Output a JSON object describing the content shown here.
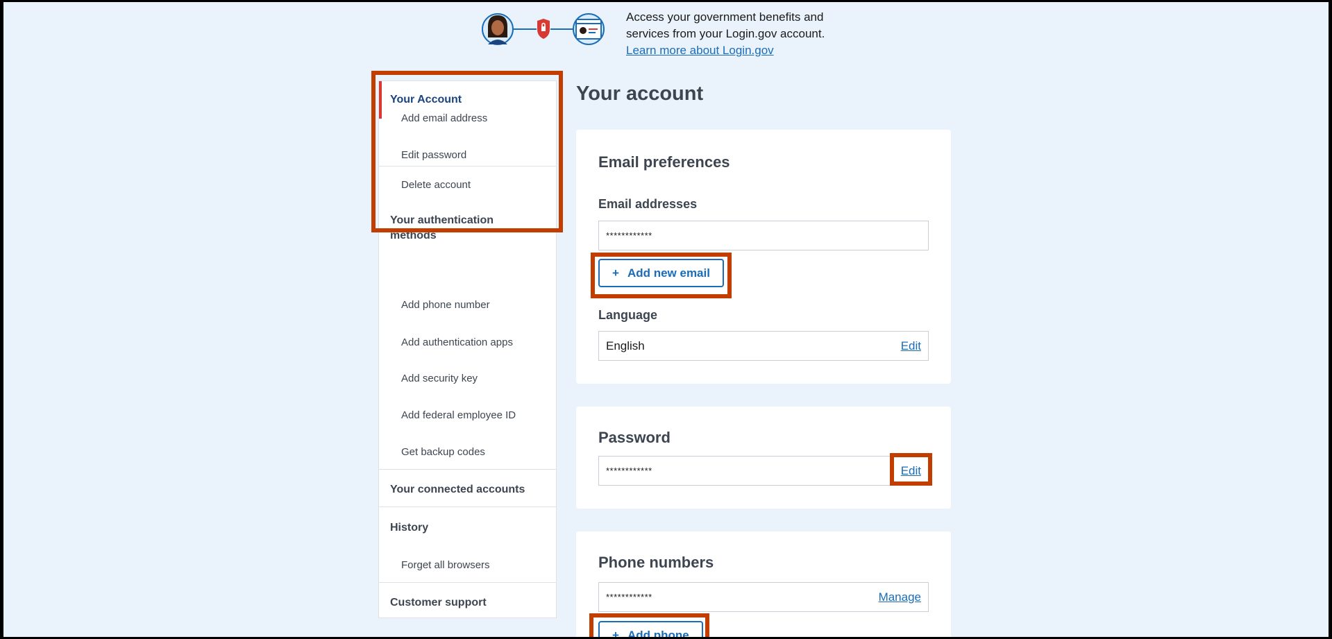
{
  "banner": {
    "text_line1": "Access your government benefits and",
    "text_line2": "services from your Login.gov account.",
    "learn_more": "Learn more about Login.gov"
  },
  "sidenav": {
    "account_head": "Your Account",
    "account_items": [
      "Add email address",
      "Edit password",
      "Delete account"
    ],
    "auth_head_line1": "Your authentication",
    "auth_head_line2": "methods",
    "auth_items": [
      "Add phone number",
      "Add authentication apps",
      "Add security key",
      "Add federal employee ID",
      "Get backup codes"
    ],
    "connected_head": "Your connected accounts",
    "history_head": "History",
    "history_items": [
      "Forget all browsers"
    ],
    "support_head": "Customer support"
  },
  "main": {
    "title": "Your account",
    "email_card": {
      "title": "Email preferences",
      "addresses_label": "Email addresses",
      "email_value": "************",
      "add_email_button": "Add new email",
      "language_label": "Language",
      "language_value": "English",
      "language_edit": "Edit"
    },
    "password_card": {
      "title": "Password",
      "password_value": "************",
      "edit": "Edit"
    },
    "phone_card": {
      "title": "Phone numbers",
      "phone_value": "************",
      "manage": "Manage",
      "add_phone_button": "Add phone"
    }
  },
  "icons": {
    "plus": "+"
  },
  "colors": {
    "page_bg": "#eaf3fb",
    "link": "#1a6cb8",
    "active_bar": "#d83933",
    "highlight": "#c23d00"
  }
}
